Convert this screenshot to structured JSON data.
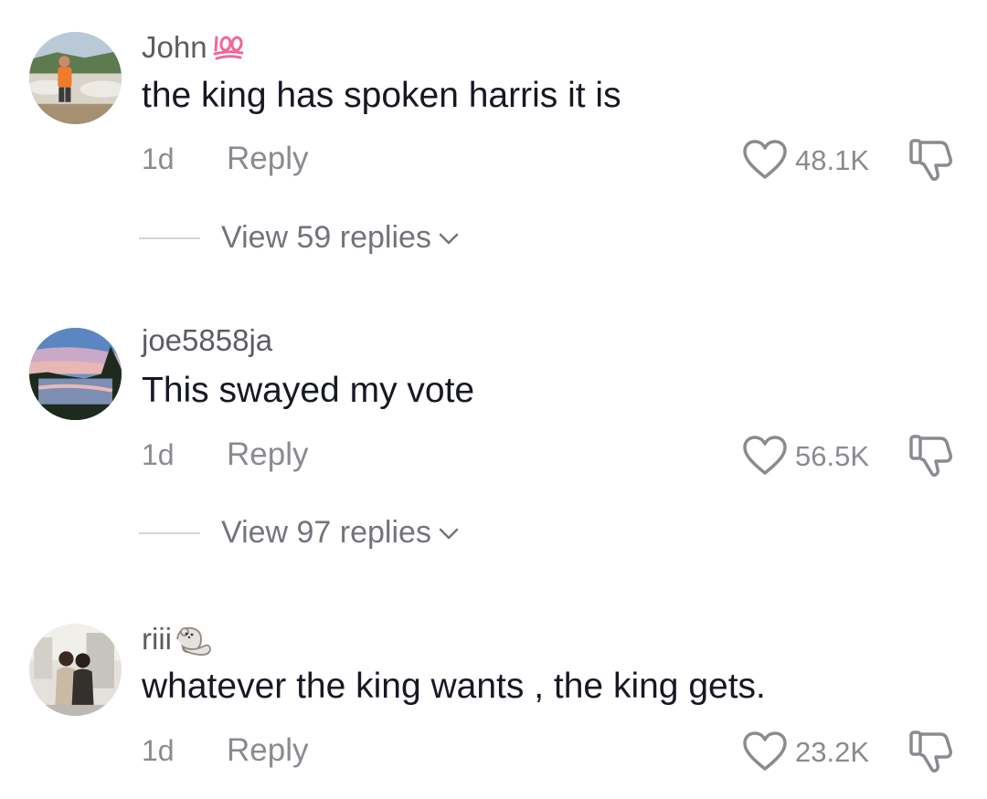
{
  "comments": [
    {
      "username": "John",
      "badge_icon": "hundred-points-emoji",
      "text": "the king has spoken harris it is",
      "time": "1d",
      "reply_label": "Reply",
      "likes": "48.1K",
      "view_replies": "View 59 replies"
    },
    {
      "username": "joe5858ja",
      "text": "This swayed my vote",
      "time": "1d",
      "reply_label": "Reply",
      "likes": "56.5K",
      "view_replies": "View 97 replies"
    },
    {
      "username": "riii",
      "badge_icon": "otter-emoji",
      "text": "whatever the king wants , the king gets.",
      "time": "1d",
      "reply_label": "Reply",
      "likes": "23.2K"
    }
  ],
  "icons": {
    "like": "heart-outline-icon",
    "dislike": "thumbs-down-outline-icon",
    "expand": "chevron-down-icon"
  },
  "colors": {
    "primary_text": "#161823",
    "secondary_text": "#8a8b91",
    "badge_pink": "#f0689a"
  }
}
